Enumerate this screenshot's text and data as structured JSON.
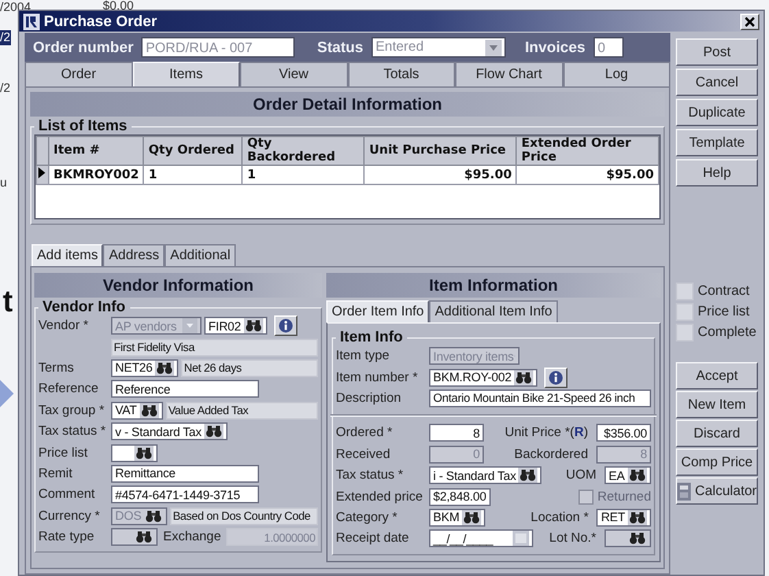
{
  "background_window": {
    "texts": [
      {
        "text": "/2004",
        "selected": false
      },
      {
        "text": "$0.00",
        "selected": false
      },
      {
        "text": "/2",
        "selected": true
      },
      {
        "text": "/2",
        "selected": false
      },
      {
        "text": "u",
        "selected": false
      },
      {
        "text": "t",
        "selected": false
      }
    ]
  },
  "window": {
    "title": "Purchase Order"
  },
  "header": {
    "order_number_label": "Order number",
    "order_number": "PORD/RUA - 007",
    "status_label": "Status",
    "status": "Entered",
    "invoices_label": "Invoices",
    "invoices": "0"
  },
  "tabs": [
    {
      "label": "Order",
      "selected": false
    },
    {
      "label": "Items",
      "selected": true
    },
    {
      "label": "View",
      "selected": false
    },
    {
      "label": "Totals",
      "selected": false
    },
    {
      "label": "Flow Chart",
      "selected": false
    },
    {
      "label": "Log",
      "selected": false
    }
  ],
  "section_title": "Order Detail Information",
  "items_table": {
    "title": "List of Items",
    "columns": [
      "Item #",
      "Qty Ordered",
      "Qty Backordered",
      "Unit Purchase Price",
      "Extended Order Price"
    ],
    "rows": [
      {
        "selected": true,
        "cells": [
          "BKMROY002",
          "1",
          "1",
          "$95.00",
          "$95.00"
        ]
      }
    ]
  },
  "sub_tabs": [
    {
      "label": "Add items",
      "selected": true
    },
    {
      "label": "Address",
      "selected": false
    },
    {
      "label": "Additional",
      "selected": false
    }
  ],
  "vendor": {
    "title": "Vendor Information",
    "group": "Vendor Info",
    "rows": [
      {
        "parts": [
          {
            "kind": "label",
            "text": "Vendor *"
          },
          {
            "kind": "combo",
            "value": "AP vendors",
            "disabled": true
          },
          {
            "kind": "lookup",
            "value": "FIR02",
            "disabled": false
          },
          {
            "kind": "info"
          }
        ]
      },
      {
        "parts": [
          {
            "kind": "label"
          },
          {
            "kind": "display",
            "value": "First Fidelity Visa",
            "disabled": false
          }
        ]
      },
      {
        "parts": [
          {
            "kind": "label",
            "text": "Terms"
          },
          {
            "kind": "lookup",
            "value": "NET26",
            "disabled": false
          },
          {
            "kind": "display",
            "value": "Net 26 days",
            "disabled": false
          }
        ]
      },
      {
        "parts": [
          {
            "kind": "label",
            "text": "Reference"
          },
          {
            "kind": "text",
            "value": "Reference"
          }
        ]
      },
      {
        "parts": [
          {
            "kind": "label",
            "text": "Tax group *"
          },
          {
            "kind": "lookup",
            "value": "VAT",
            "disabled": false
          },
          {
            "kind": "display",
            "value": "Value Added Tax",
            "disabled": false
          }
        ]
      },
      {
        "parts": [
          {
            "kind": "label",
            "text": "Tax status *"
          },
          {
            "kind": "lookup",
            "value": "v - Standard Tax",
            "disabled": false
          }
        ]
      },
      {
        "parts": [
          {
            "kind": "label",
            "text": "Price list"
          },
          {
            "kind": "lookup",
            "disabled": false
          }
        ]
      },
      {
        "parts": [
          {
            "kind": "label",
            "text": "Remit"
          },
          {
            "kind": "text",
            "value": "Remittance"
          }
        ]
      },
      {
        "parts": [
          {
            "kind": "label",
            "text": "Comment"
          },
          {
            "kind": "text",
            "value": "#4574-6471-1449-3715"
          }
        ]
      },
      {
        "parts": [
          {
            "kind": "label",
            "text": "Currency *"
          },
          {
            "kind": "lookup",
            "value": "DOS",
            "disabled": true
          },
          {
            "kind": "display",
            "value": "Based on Dos Country Code",
            "disabled": false
          }
        ]
      },
      {
        "parts": [
          {
            "kind": "label",
            "text": "Rate type"
          },
          {
            "kind": "lookup",
            "disabled": true
          },
          {
            "kind": "caption",
            "text": "Exchange"
          },
          {
            "kind": "display",
            "value": "1.0000000",
            "disabled": true
          }
        ]
      }
    ]
  },
  "item": {
    "title": "Item Information",
    "tabs": [
      {
        "label": "Order Item Info",
        "selected": true
      },
      {
        "label": "Additional Item Info",
        "selected": false
      }
    ],
    "group": "Item Info",
    "rows": [
      {
        "parts": [
          {
            "kind": "label",
            "text": "Item type"
          },
          {
            "kind": "combo",
            "value": "Inventory items",
            "disabled": true
          }
        ]
      },
      {
        "parts": [
          {
            "kind": "label",
            "text": "Item number *"
          },
          {
            "kind": "lookup",
            "value": "BKM.ROY-002",
            "disabled": false
          },
          {
            "kind": "info"
          }
        ]
      },
      {
        "parts": [
          {
            "kind": "label",
            "text": "Description"
          },
          {
            "kind": "text",
            "value": "Ontario Mountain Bike 21-Speed 26 inch"
          }
        ]
      }
    ],
    "rows2": [
      {
        "parts": [
          {
            "kind": "label",
            "text": "Ordered *"
          },
          {
            "kind": "number",
            "value": "8",
            "disabled": false
          },
          {
            "kind": "caption",
            "text": "Unit Price *(**R**)"
          },
          {
            "kind": "number",
            "value": "$356.00",
            "disabled": false
          }
        ]
      },
      {
        "parts": [
          {
            "kind": "label",
            "text": "Received"
          },
          {
            "kind": "number",
            "value": "0",
            "disabled": true
          },
          {
            "kind": "caption",
            "text": "Backordered"
          },
          {
            "kind": "number",
            "value": "8",
            "disabled": true
          }
        ]
      },
      {
        "parts": [
          {
            "kind": "label",
            "text": "Tax status *"
          },
          {
            "kind": "lookup",
            "value": "i - Standard Tax",
            "disabled": false
          },
          {
            "kind": "caption",
            "text": "UOM"
          },
          {
            "kind": "lookup",
            "value": "EA",
            "disabled": false
          }
        ]
      },
      {
        "parts": [
          {
            "kind": "label",
            "text": "Extended price"
          },
          {
            "kind": "number",
            "value": "$2,848.00",
            "disabled": false
          },
          {
            "kind": "check",
            "label": "Returned",
            "checked": false,
            "disabled": true
          }
        ]
      },
      {
        "parts": [
          {
            "kind": "label",
            "text": "Category *"
          },
          {
            "kind": "lookup",
            "value": "BKM",
            "disabled": false
          },
          {
            "kind": "caption",
            "text": "Location *"
          },
          {
            "kind": "lookup",
            "value": "RET",
            "disabled": false
          }
        ]
      },
      {
        "parts": [
          {
            "kind": "label",
            "text": "Receipt date"
          },
          {
            "kind": "date",
            "value": "__/__/____"
          },
          {
            "kind": "caption",
            "text": "Lot No.*"
          },
          {
            "kind": "lookup",
            "disabled": true
          }
        ]
      }
    ]
  },
  "side_buttons": [
    {
      "label": "Post"
    },
    {
      "label": "Cancel"
    },
    {
      "label": "Duplicate"
    },
    {
      "label": "Template"
    },
    {
      "label": "Help"
    }
  ],
  "options": [
    {
      "label": "Contract",
      "checked": false
    },
    {
      "label": "Price list",
      "checked": false
    },
    {
      "label": "Complete",
      "checked": false
    }
  ],
  "action_buttons": [
    {
      "label": "Accept",
      "kind": "plain"
    },
    {
      "label": "New Item",
      "kind": "plain"
    },
    {
      "label": "Discard",
      "kind": "plain"
    },
    {
      "label": "Comp Price",
      "kind": "plain"
    },
    {
      "label": "Calculator",
      "kind": "calculator"
    }
  ]
}
